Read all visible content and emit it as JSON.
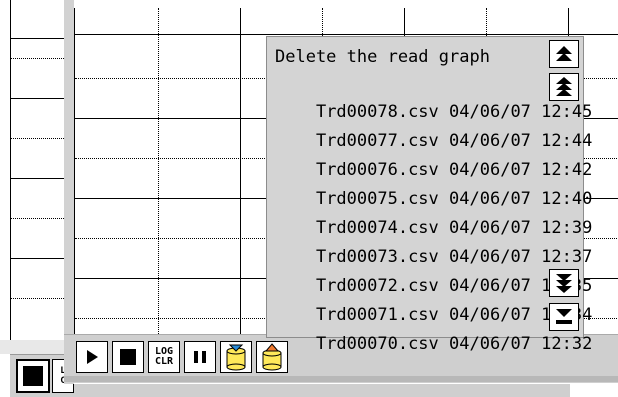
{
  "back_window": {
    "log_clear_label_1": "L",
    "log_clear_label_2": "C"
  },
  "toolbar": {
    "play_icon": "play-icon",
    "stop_icon": "stop-icon",
    "log_clear_line1": "LOG",
    "log_clear_line2": "CLR",
    "pause_icon": "pause-icon",
    "save_icon": "save-blue-arrow-icon",
    "load_icon": "load-orange-arrow-icon"
  },
  "file_list": {
    "header": "Delete the read graph",
    "items": [
      {
        "name": "Trd00078.csv",
        "date": "04/06/07",
        "time": "12:45"
      },
      {
        "name": "Trd00077.csv",
        "date": "04/06/07",
        "time": "12:44"
      },
      {
        "name": "Trd00076.csv",
        "date": "04/06/07",
        "time": "12:42"
      },
      {
        "name": "Trd00075.csv",
        "date": "04/06/07",
        "time": "12:40"
      },
      {
        "name": "Trd00074.csv",
        "date": "04/06/07",
        "time": "12:39"
      },
      {
        "name": "Trd00073.csv",
        "date": "04/06/07",
        "time": "12:37"
      },
      {
        "name": "Trd00072.csv",
        "date": "04/06/07",
        "time": "12:35"
      },
      {
        "name": "Trd00071.csv",
        "date": "04/06/07",
        "time": "12:34"
      },
      {
        "name": "Trd00070.csv",
        "date": "04/06/07",
        "time": "12:32"
      }
    ],
    "scroll_icons": [
      "double-up-icon",
      "double-up-icon",
      "double-down-icon",
      "double-down-icon"
    ]
  },
  "colors": {
    "panel_gray": "#d4d4d4",
    "save_arrow": "#2a8cd6",
    "load_arrow": "#f07a30",
    "cylinder_yellow": "#ffe95a"
  }
}
